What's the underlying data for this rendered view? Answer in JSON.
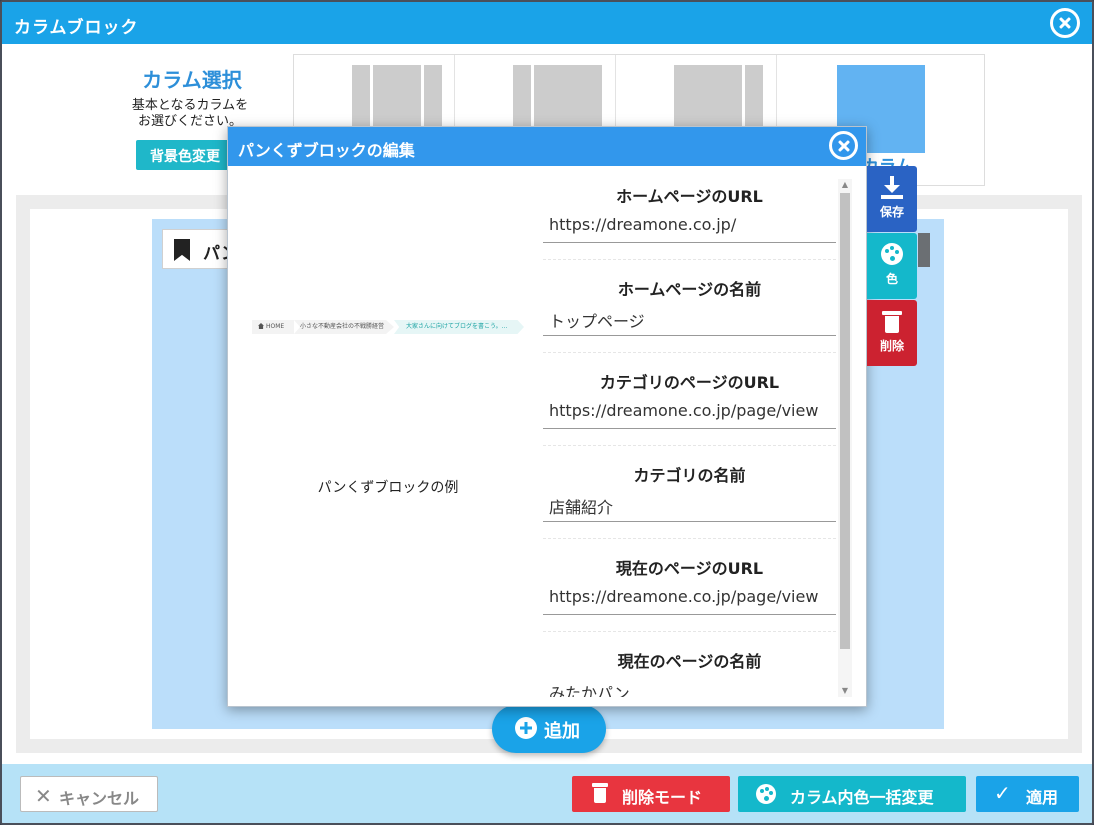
{
  "window": {
    "title": "カラムブロック"
  },
  "column_select": {
    "heading": "カラム選択",
    "description_line1": "基本となるカラムを",
    "description_line2": "お選びください。",
    "bg_color_button": "背景色変更",
    "selected_label": "カラム"
  },
  "block": {
    "label": "パン"
  },
  "add_button": "追加",
  "footer": {
    "cancel": "キャンセル",
    "delete_mode": "削除モード",
    "color_all": "カラム内色一括変更",
    "apply": "適用"
  },
  "modal": {
    "title": "パンくずブロックの編集",
    "preview": {
      "crumb_home": "HOME",
      "crumb_category": "小さな不動産会社の不戦勝経営",
      "crumb_current": "大家さんに向けてブログを書こう。…",
      "caption": "パンくずブロックの例"
    },
    "fields": [
      {
        "label": "ホームページのURL",
        "value": "https://dreamone.co.jp/"
      },
      {
        "label": "ホームページの名前",
        "value": "トップページ"
      },
      {
        "label": "カテゴリのページのURL",
        "value": "https://dreamone.co.jp/page/view"
      },
      {
        "label": "カテゴリの名前",
        "value": "店舗紹介"
      },
      {
        "label": "現在のページのURL",
        "value": "https://dreamone.co.jp/page/view"
      },
      {
        "label": "現在のページの名前",
        "value": "みたかパン"
      }
    ]
  },
  "side_actions": {
    "save": "保存",
    "color": "色",
    "delete": "削除"
  },
  "colors": {
    "header": "#1aa3e8",
    "modal_header": "#3297ec",
    "save": "#2a63c4",
    "color": "#14b8cb",
    "delete": "#cc2230",
    "delete_mode": "#e8353f"
  }
}
